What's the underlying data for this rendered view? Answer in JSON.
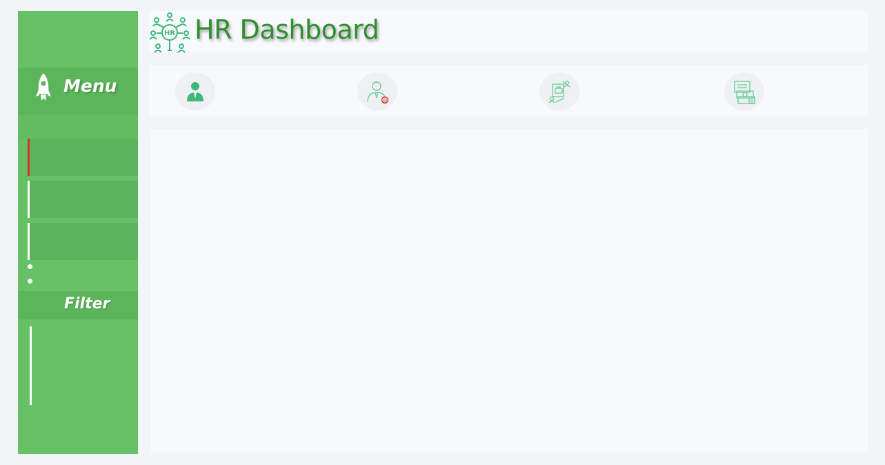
{
  "header": {
    "title": "HR Dashboard",
    "logo_icon": "hr-network-icon"
  },
  "sidebar": {
    "menu_label": "Menu",
    "menu_icon": "rocket-icon",
    "filter_label": "Filter",
    "active_color": "#d6332a",
    "background_color": "#66c066"
  },
  "kpis": [
    {
      "icon": "employee-icon"
    },
    {
      "icon": "employee-email-icon"
    },
    {
      "icon": "recruitment-icon"
    },
    {
      "icon": "payroll-icon"
    }
  ],
  "colors": {
    "brand_green": "#2f8f2f",
    "icon_green": "#3cb878",
    "page_background": "#f3f4f8"
  }
}
